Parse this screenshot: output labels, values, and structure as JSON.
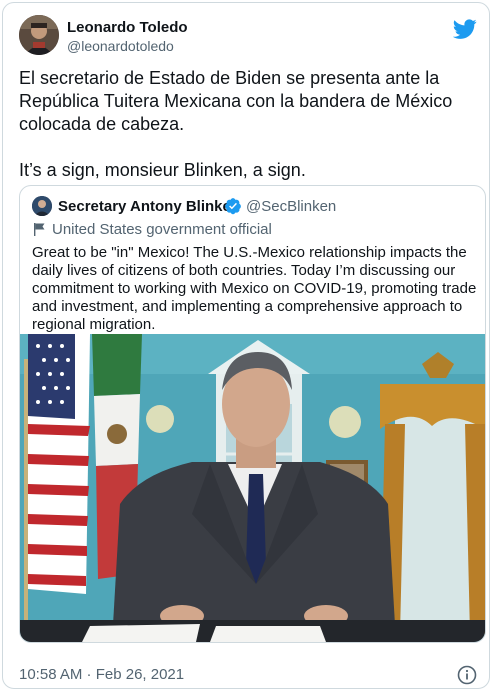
{
  "author": {
    "name": "Leonardo Toledo",
    "handle": "@leonardotoledo"
  },
  "tweet": {
    "paragraph1": "El secretario de Estado de Biden se presenta ante la República Tuitera Mexicana con la bandera de México colocada de cabeza.",
    "paragraph2": "It’s a sign, monsieur Blinken, a sign."
  },
  "quoted": {
    "name": "Secretary Antony Blinken",
    "handle": "@SecBlinken",
    "label": "United States government official",
    "text": "Great to be \"in\" Mexico! The U.S.-Mexico relationship impacts the daily lives of citizens of both countries. Today I’m discussing our commitment to working with Mexico on COVID-19, promoting trade and investment, and implementing a comprehensive approach to regional migration."
  },
  "footer": {
    "timestamp": "10:58 AM · Feb 26, 2021"
  },
  "colors": {
    "twitter_blue": "#1d9bf0",
    "text": "#0f1419",
    "secondary_text": "#536471",
    "border": "#cfd9de",
    "wall": "#4fa6b8"
  },
  "icons": [
    "twitter-bird-icon",
    "verified-badge-icon",
    "government-flag-icon",
    "info-icon"
  ]
}
